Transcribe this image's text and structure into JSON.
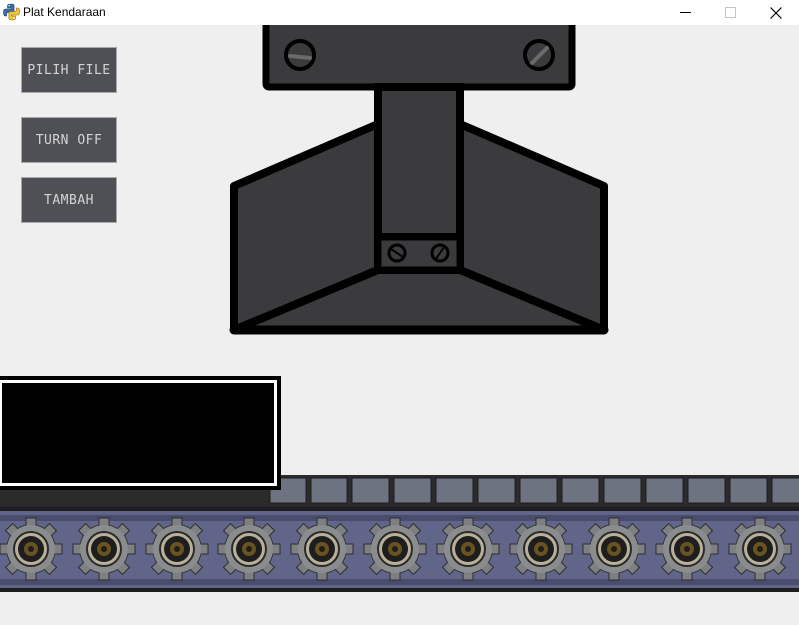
{
  "window": {
    "title": "Plat Kendaraan",
    "controls": {
      "minimize_icon": "minimize-icon",
      "maximize_icon": "maximize-icon",
      "close_icon": "close-icon"
    }
  },
  "buttons": {
    "pilih_file": "PILIH FILE",
    "turn_off": "TURN OFF",
    "tambah": "TAMBAH"
  },
  "plate_display": {
    "text": ""
  },
  "colors": {
    "canvas_bg": "#efefef",
    "button_bg": "#4e5055",
    "button_text": "#d4d4d4",
    "machine_body": "#3b3b3d",
    "conveyor_belt": "#62658a",
    "conveyor_plate": "#6d7380"
  }
}
